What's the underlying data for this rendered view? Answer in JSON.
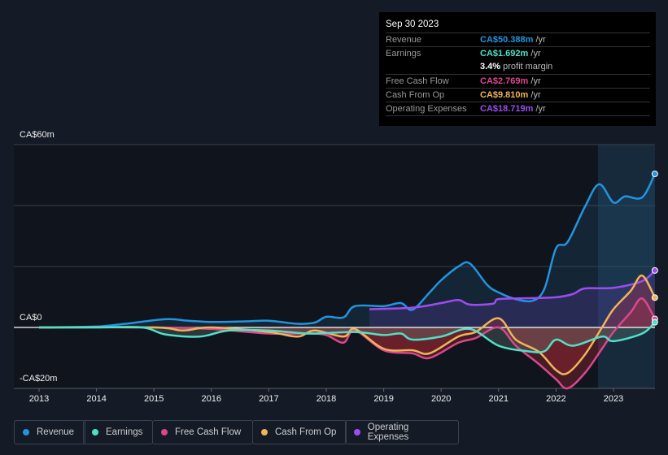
{
  "tooltip": {
    "date": "Sep 30 2023",
    "rows": [
      {
        "label": "Revenue",
        "value": "CA$50.388m",
        "unit": " /yr",
        "color": "#2394df"
      },
      {
        "label": "Earnings",
        "value": "CA$1.692m",
        "unit": " /yr",
        "color": "#4fe0c8"
      },
      {
        "label": "",
        "value": "3.4%",
        "unit": " profit margin",
        "color": "#ffffff"
      },
      {
        "label": "Free Cash Flow",
        "value": "CA$2.769m",
        "unit": " /yr",
        "color": "#d9478c"
      },
      {
        "label": "Cash From Op",
        "value": "CA$9.810m",
        "unit": " /yr",
        "color": "#f0b35a"
      },
      {
        "label": "Operating Expenses",
        "value": "CA$18.719m",
        "unit": " /yr",
        "color": "#9d4cf0"
      }
    ]
  },
  "chart_data": {
    "type": "line",
    "ylim": [
      -20,
      60
    ],
    "xlim": [
      2012.6,
      2023.75
    ],
    "y_tick_labels": [
      "CA$60m",
      "CA$0",
      "-CA$20m"
    ],
    "y_ticks": [
      60,
      0,
      -20
    ],
    "x_tick_labels": [
      "2013",
      "2014",
      "2015",
      "2016",
      "2017",
      "2018",
      "2019",
      "2020",
      "2021",
      "2022",
      "2023"
    ],
    "highlight_from": 2022.73,
    "grid": true,
    "legend_placement": "bottom",
    "series": [
      {
        "name": "Revenue",
        "color": "#2394df",
        "x": [
          2013,
          2014,
          2014.5,
          2015.2,
          2015.6,
          2016,
          2016.6,
          2017,
          2017.5,
          2017.8,
          2018,
          2018.3,
          2018.5,
          2019,
          2019.3,
          2019.5,
          2019.8,
          2020,
          2020.3,
          2020.5,
          2020.8,
          2021,
          2021.3,
          2021.6,
          2021.8,
          2022,
          2022.2,
          2022.5,
          2022.75,
          2023,
          2023.2,
          2023.5,
          2023.72
        ],
        "y": [
          0,
          0.3,
          1.2,
          2.7,
          2.2,
          1.8,
          2,
          2.2,
          1.2,
          1.6,
          3.5,
          3.3,
          7,
          7,
          8,
          5.8,
          11.5,
          15.5,
          20,
          21,
          14,
          11.5,
          9.3,
          8.8,
          12.8,
          26,
          28,
          39.5,
          47,
          41,
          43,
          42.7,
          50.4
        ]
      },
      {
        "name": "Earnings",
        "color": "#4fe0c8",
        "x": [
          2013,
          2014,
          2014.8,
          2015.2,
          2015.8,
          2016.3,
          2017,
          2017.7,
          2018.5,
          2019,
          2019.3,
          2019.5,
          2020,
          2020.5,
          2021,
          2021.5,
          2021.8,
          2022,
          2022.3,
          2022.8,
          2023,
          2023.5,
          2023.72
        ],
        "y": [
          0,
          0,
          0,
          -2.3,
          -3,
          -1,
          -1,
          -2,
          -1.5,
          -2.5,
          -2,
          -4,
          -3,
          -0.5,
          -6,
          -7.8,
          -7.8,
          -4,
          -6,
          -3,
          -4.5,
          -2,
          1.7
        ]
      },
      {
        "name": "Free Cash Flow",
        "color": "#d9478c",
        "x": [
          2013,
          2015,
          2016,
          2017,
          2017.7,
          2018,
          2018.3,
          2018.5,
          2019,
          2019.5,
          2019.8,
          2020.3,
          2020.6,
          2021,
          2021.3,
          2021.7,
          2022,
          2022.2,
          2022.5,
          2022.8,
          2023,
          2023.3,
          2023.5,
          2023.72
        ],
        "y": [
          0,
          0,
          -0.5,
          -2,
          -2,
          -2.5,
          -5,
          -1,
          -7.5,
          -8.5,
          -10,
          -5,
          -3.5,
          0,
          -6,
          -12,
          -17,
          -20,
          -15,
          -7,
          -1.5,
          5,
          9.5,
          2.8
        ]
      },
      {
        "name": "Cash From Op",
        "color": "#f0b35a",
        "x": [
          2013,
          2015,
          2015.5,
          2016,
          2017,
          2017.5,
          2017.8,
          2018.3,
          2018.5,
          2019,
          2019.5,
          2019.8,
          2020.3,
          2020.6,
          2021,
          2021.3,
          2021.7,
          2022,
          2022.2,
          2022.5,
          2022.8,
          2023,
          2023.3,
          2023.5,
          2023.72
        ],
        "y": [
          0,
          0,
          -1,
          0,
          -1.5,
          -3,
          -1,
          -3,
          -0.5,
          -7,
          -7.5,
          -8.5,
          -3,
          -1.5,
          3,
          -4,
          -8,
          -14,
          -15,
          -9,
          0,
          6,
          12,
          17,
          9.8
        ]
      },
      {
        "name": "Operating Expenses",
        "color": "#9d4cf0",
        "x": [
          2018.75,
          2019.5,
          2020,
          2020.3,
          2020.5,
          2020.9,
          2021,
          2021.5,
          2022,
          2022.3,
          2022.5,
          2023,
          2023.5,
          2023.72
        ],
        "y": [
          6,
          6.5,
          8,
          9,
          7.5,
          7.8,
          9.3,
          9.6,
          9.9,
          11,
          12.8,
          13,
          15.2,
          18.7
        ]
      }
    ]
  },
  "legend": [
    "Revenue",
    "Earnings",
    "Free Cash Flow",
    "Cash From Op",
    "Operating Expenses"
  ]
}
